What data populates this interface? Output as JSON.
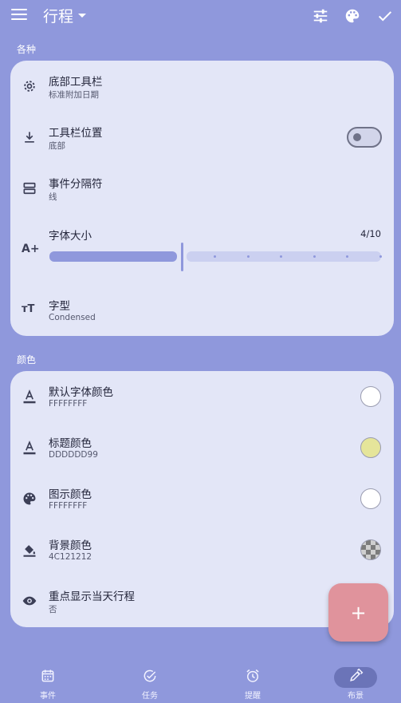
{
  "header": {
    "title": "行程",
    "icons": [
      "menu-icon",
      "tune-icon",
      "palette-icon",
      "check-icon"
    ]
  },
  "sections": {
    "misc_label": "各种",
    "colors_label": "颜色"
  },
  "misc": {
    "bottom_toolbar": {
      "title": "底部工具栏",
      "subtitle": "标准附加日期",
      "icon": "gear-icon"
    },
    "toolbar_position": {
      "title": "工具栏位置",
      "subtitle": "底部",
      "icon": "download-icon",
      "toggle_on": false
    },
    "event_separator": {
      "title": "事件分隔符",
      "subtitle": "线",
      "icon": "separator-icon"
    },
    "font_size": {
      "title": "字体大小",
      "value_text": "4/10",
      "value": 4,
      "max": 10,
      "icon": "font-size-icon"
    },
    "typeface": {
      "title": "字型",
      "subtitle": "Condensed",
      "icon": "typeface-icon"
    }
  },
  "colors": {
    "default_font": {
      "title": "默认字体颜色",
      "subtitle": "FFFFFFFF",
      "icon": "text-color-icon",
      "swatch": "#ffffff"
    },
    "title_color": {
      "title": "标题颜色",
      "subtitle": "DDDDDD99",
      "icon": "text-color-icon",
      "swatch": "#e5e59a"
    },
    "icon_color": {
      "title": "图示颜色",
      "subtitle": "FFFFFFFF",
      "icon": "palette-icon",
      "swatch": "#ffffff"
    },
    "background_color": {
      "title": "背景颜色",
      "subtitle": "4C121212",
      "icon": "fill-icon",
      "swatch": "checker"
    },
    "highlight_today": {
      "title": "重点显示当天行程",
      "subtitle": "否",
      "icon": "eye-icon"
    }
  },
  "fab": {
    "label": "+"
  },
  "nav": [
    {
      "label": "事件",
      "icon": "calendar-icon"
    },
    {
      "label": "任务",
      "icon": "check-circle-icon"
    },
    {
      "label": "提醒",
      "icon": "alarm-icon"
    },
    {
      "label": "布景",
      "icon": "eyedropper-icon",
      "active": true
    }
  ],
  "theme": {
    "background": "#8f98dc",
    "card": "#e3e6f7",
    "accent": "#8f98dc",
    "fab": "#e0939c"
  }
}
